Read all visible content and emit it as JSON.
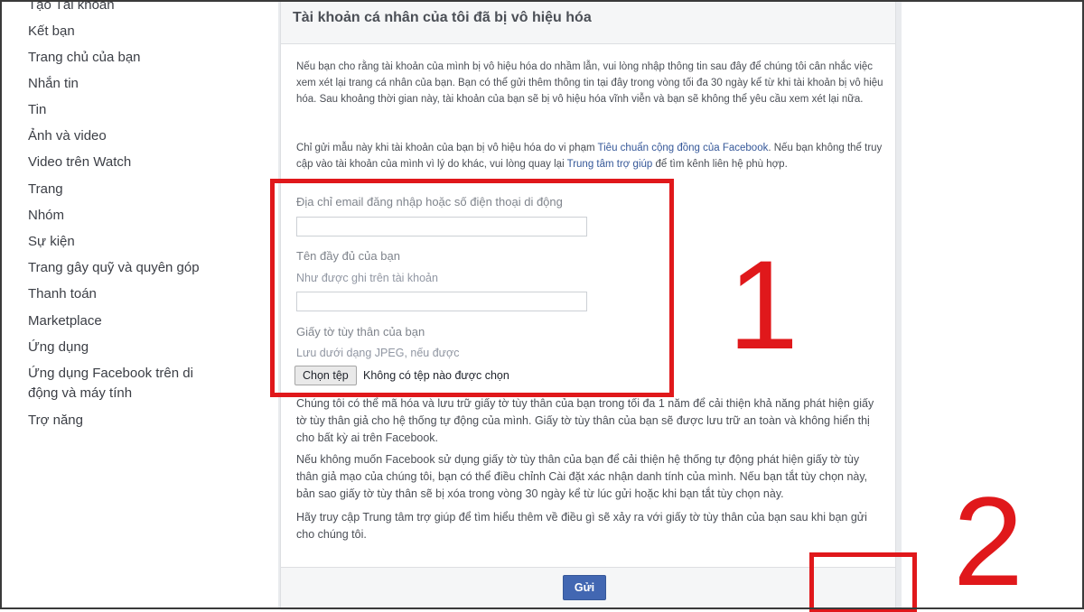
{
  "sidebar": {
    "items": [
      {
        "label": "Tạo Tài khoản"
      },
      {
        "label": "Kết bạn"
      },
      {
        "label": "Trang chủ của bạn"
      },
      {
        "label": "Nhắn tin"
      },
      {
        "label": "Tin"
      },
      {
        "label": "Ảnh và video"
      },
      {
        "label": "Video trên Watch"
      },
      {
        "label": "Trang"
      },
      {
        "label": "Nhóm"
      },
      {
        "label": "Sự kiện"
      },
      {
        "label": "Trang gây quỹ và quyên góp"
      },
      {
        "label": "Thanh toán"
      },
      {
        "label": "Marketplace"
      },
      {
        "label": "Ứng dụng"
      },
      {
        "label": "Ứng dụng Facebook trên di động và máy tính"
      },
      {
        "label": "Trợ năng"
      }
    ]
  },
  "form": {
    "title": "Tài khoản cá nhân của tôi đã bị vô hiệu hóa",
    "intro": "Nếu bạn cho rằng tài khoản của mình bị vô hiệu hóa do nhầm lẫn, vui lòng nhập thông tin sau đây để chúng tôi cân nhắc việc xem xét lại trang cá nhân của bạn. Bạn có thể gửi thêm thông tin tại đây trong vòng tối đa 30 ngày kể từ khi tài khoản bị vô hiệu hóa. Sau khoảng thời gian này, tài khoản của bạn sẽ bị vô hiệu hóa vĩnh viễn và bạn sẽ không thể yêu cầu xem xét lại nữa.",
    "notice_before": "Chỉ gửi mẫu này khi tài khoản của bạn bị vô hiệu hóa do vi phạm ",
    "notice_link1": "Tiêu chuẩn cộng đồng của Facebook",
    "notice_middle": ". Nếu bạn không thể truy cập vào tài khoản của mình vì lý do khác, vui lòng quay lại ",
    "notice_link2": "Trung tâm trợ giúp",
    "notice_after": " để tìm kênh liên hệ phù hợp.",
    "email_label": "Địa chỉ email đăng nhập hoặc số điện thoại di động",
    "email_value": "",
    "name_label": "Tên đầy đủ của bạn",
    "name_hint": "Như được ghi trên tài khoản",
    "name_value": "",
    "id_label": "Giấy tờ tùy thân của bạn",
    "id_hint": "Lưu dưới dạng JPEG, nếu được",
    "file_button": "Chọn tệp",
    "file_status": "Không có tệp nào được chọn",
    "encrypt_text": "Chúng tôi có thể mã hóa và lưu trữ giấy tờ tùy thân của bạn trong tối đa 1 năm để cải thiện khả năng phát hiện giấy tờ tùy thân giả cho hệ thống tự động của mình. Giấy tờ tùy thân của bạn sẽ được lưu trữ an toàn và không hiển thị cho bất kỳ ai trên Facebook.",
    "optout_before": "Nếu không muốn Facebook sử dụng giấy tờ tùy thân của bạn để cải thiện hệ thống tự động phát hiện giấy tờ tùy thân giả mạo của chúng tôi, bạn có thể điều chỉnh ",
    "optout_link": "Cài đặt xác nhận danh tính",
    "optout_after": " của mình. Nếu bạn tắt tùy chọn này, bản sao giấy tờ tùy thân sẽ bị xóa trong vòng 30 ngày kể từ lúc gửi hoặc khi bạn tắt tùy chọn này.",
    "help_before": "Hãy truy cập Trung tâm trợ giúp để tìm hiểu thêm về ",
    "help_link": "điều gì sẽ xảy ra với giấy tờ tùy thân của bạn",
    "help_after": " sau khi bạn gửi cho chúng tôi.",
    "submit_label": "Gửi"
  },
  "annotations": {
    "step1": "1",
    "step2": "2",
    "color": "#e0181b"
  },
  "colors": {
    "link": "#365899",
    "button": "#4267b2",
    "header_bg": "#f5f6f7",
    "page_gray": "#e9ebee"
  }
}
